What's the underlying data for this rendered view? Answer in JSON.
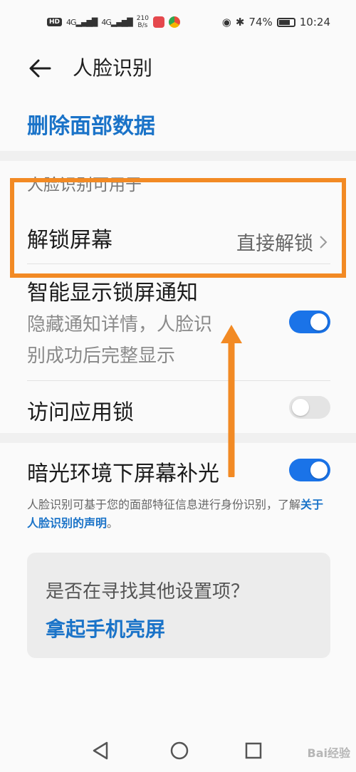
{
  "status_bar": {
    "hd": "HD",
    "signal1": "4G",
    "signal2": "4G",
    "speed": "210",
    "speed_unit": "B/s",
    "battery": "74%",
    "time": "10:24"
  },
  "header": {
    "title": "人脸识别"
  },
  "delete_link": "删除面部数据",
  "section_label": "人脸识别可用于",
  "settings": {
    "unlock_screen": {
      "title": "解锁屏幕",
      "value": "直接解锁"
    },
    "smart_notifications": {
      "title": "智能显示锁屏通知",
      "subtitle_line1": "隐藏通知详情，人脸识",
      "subtitle_line2": "别成功后完整显示",
      "enabled": true
    },
    "app_lock": {
      "title": "访问应用锁",
      "enabled": false
    },
    "fill_light": {
      "title": "暗光环境下屏幕补光",
      "enabled": true
    }
  },
  "note": {
    "text": "人脸识别可基于您的面部特征信息进行身份识别，了解",
    "link": "关于人脸识别的声明",
    "end": "。"
  },
  "suggest": {
    "question": "是否在寻找其他设置项？",
    "link": "拿起手机亮屏"
  },
  "watermark": "Bai经验",
  "colors": {
    "accent": "#1a73c8",
    "toggle_on": "#1a73e8",
    "annotation": "#f28a24"
  }
}
